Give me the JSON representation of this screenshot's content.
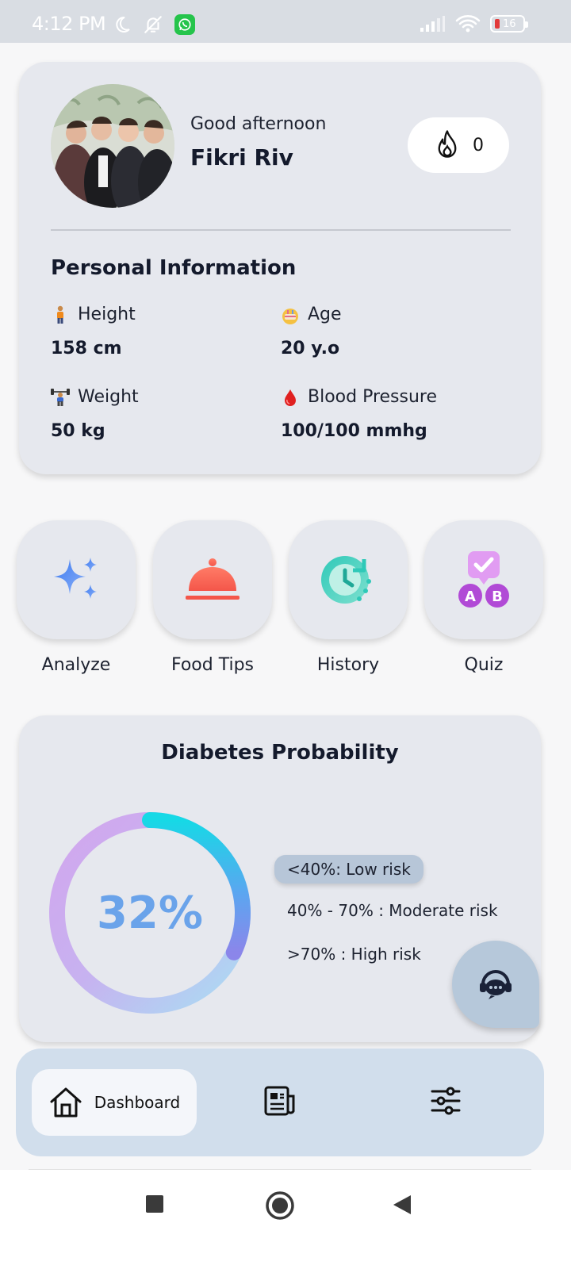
{
  "status_bar": {
    "time": "4:12 PM",
    "battery": "16",
    "icons": [
      "moon-icon",
      "bell-off-icon",
      "whatsapp-icon",
      "signal-icon",
      "wifi-icon",
      "battery-icon"
    ]
  },
  "profile": {
    "greeting": "Good afternoon",
    "name": "Fikri Riv",
    "streak_count": "0"
  },
  "personal_info": {
    "title": "Personal Information",
    "height": {
      "label": "Height",
      "value": "158 cm"
    },
    "age": {
      "label": "Age",
      "value": "20 y.o"
    },
    "weight": {
      "label": "Weight",
      "value": "50 kg"
    },
    "blood_pressure": {
      "label": "Blood Pressure",
      "value": "100/100 mmhg"
    }
  },
  "menu": [
    {
      "label": "Analyze",
      "icon": "sparkle-icon"
    },
    {
      "label": "Food Tips",
      "icon": "food-cloche-icon"
    },
    {
      "label": "History",
      "icon": "history-icon"
    },
    {
      "label": "Quiz",
      "icon": "quiz-icon"
    }
  ],
  "probability": {
    "title": "Diabetes Probability",
    "value": 0.32,
    "value_text": "32%",
    "legend": {
      "low": "<40%: Low risk",
      "moderate": "40% - 70% : Moderate risk",
      "high": ">70% : High risk"
    },
    "active_level": "low"
  },
  "bottom_nav": {
    "dashboard_label": "Dashboard",
    "items": [
      "home-icon",
      "news-icon",
      "settings-sliders-icon"
    ]
  },
  "colors": {
    "card_bg": "#e6e8ee",
    "nav_bg": "#d1deec",
    "ring_text": "#6aa3ea",
    "legend_active_bg": "#b7c6d8"
  }
}
